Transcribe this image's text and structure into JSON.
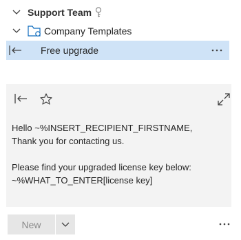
{
  "tree": {
    "team": {
      "label": "Support Team",
      "icon": "key-icon"
    },
    "folder": {
      "label": "Company Templates",
      "icon": "folder-icon"
    },
    "selected_item": {
      "label": "Free upgrade",
      "more": "···"
    }
  },
  "preview": {
    "body": "Hello ~%INSERT_RECIPIENT_FIRSTNAME,\nThank you for contacting us.\n\nPlease find your upgraded license key below:\n~%WHAT_TO_ENTER[license key]"
  },
  "footer": {
    "new_label": "New",
    "more": "···"
  },
  "colors": {
    "selection": "#cfe3f7",
    "preview_bg": "#f3f3f3",
    "accent": "#0f6cbd"
  }
}
